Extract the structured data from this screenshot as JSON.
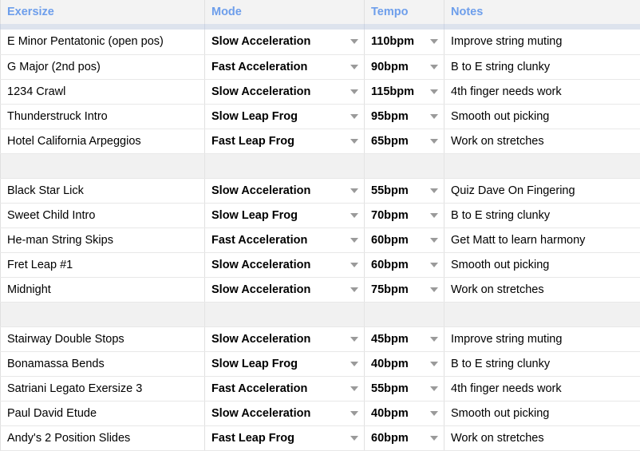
{
  "table": {
    "columns": [
      {
        "key": "exersize",
        "label": "Exersize"
      },
      {
        "key": "mode",
        "label": "Mode"
      },
      {
        "key": "tempo",
        "label": "Tempo"
      },
      {
        "key": "notes",
        "label": "Notes"
      }
    ],
    "header_text_color": "#6d9eeb",
    "header_bg_color": "#f3f3f3",
    "freeze_bar_color": "#dde3ed",
    "spacer_bg_color": "#f1f1f1",
    "dropdown_icon": "chevron-down-icon",
    "rows": [
      {
        "type": "data",
        "exersize": "E Minor Pentatonic (open pos)",
        "mode": "Slow Acceleration",
        "tempo": "110bpm",
        "notes": "Improve string muting"
      },
      {
        "type": "data",
        "exersize": "G Major (2nd pos)",
        "mode": "Fast Acceleration",
        "tempo": "90bpm",
        "notes": "B to E string clunky"
      },
      {
        "type": "data",
        "exersize": "1234 Crawl",
        "mode": "Slow Acceleration",
        "tempo": "115bpm",
        "notes": "4th finger needs work"
      },
      {
        "type": "data",
        "exersize": "Thunderstruck Intro",
        "mode": "Slow Leap Frog",
        "tempo": "95bpm",
        "notes": "Smooth out picking"
      },
      {
        "type": "data",
        "exersize": "Hotel California Arpeggios",
        "mode": "Fast Leap Frog",
        "tempo": "65bpm",
        "notes": "Work on stretches"
      },
      {
        "type": "spacer",
        "exersize": "",
        "mode": "",
        "tempo": "",
        "notes": ""
      },
      {
        "type": "data",
        "exersize": "Black Star Lick",
        "mode": "Slow Acceleration",
        "tempo": "55bpm",
        "notes": "Quiz Dave On Fingering"
      },
      {
        "type": "data",
        "exersize": "Sweet Child Intro",
        "mode": "Slow Leap Frog",
        "tempo": "70bpm",
        "notes": "B to E string clunky"
      },
      {
        "type": "data",
        "exersize": "He-man String Skips",
        "mode": "Fast Acceleration",
        "tempo": "60bpm",
        "notes": "Get Matt to learn harmony"
      },
      {
        "type": "data",
        "exersize": "Fret Leap #1",
        "mode": "Slow Acceleration",
        "tempo": "60bpm",
        "notes": "Smooth out picking"
      },
      {
        "type": "data",
        "exersize": "Midnight",
        "mode": "Slow Acceleration",
        "tempo": "75bpm",
        "notes": "Work on stretches"
      },
      {
        "type": "spacer",
        "exersize": "",
        "mode": "",
        "tempo": "",
        "notes": ""
      },
      {
        "type": "data",
        "exersize": "Stairway Double Stops",
        "mode": "Slow Acceleration",
        "tempo": "45bpm",
        "notes": "Improve string muting"
      },
      {
        "type": "data",
        "exersize": "Bonamassa Bends",
        "mode": "Slow Leap Frog",
        "tempo": "40bpm",
        "notes": "B to E string clunky"
      },
      {
        "type": "data",
        "exersize": "Satriani Legato Exersize 3",
        "mode": "Fast Acceleration",
        "tempo": "55bpm",
        "notes": "4th finger needs work"
      },
      {
        "type": "data",
        "exersize": "Paul David Etude",
        "mode": "Slow Acceleration",
        "tempo": "40bpm",
        "notes": "Smooth out picking"
      },
      {
        "type": "data",
        "exersize": "Andy's 2 Position Slides",
        "mode": "Fast Leap Frog",
        "tempo": "60bpm",
        "notes": "Work on stretches"
      }
    ]
  }
}
